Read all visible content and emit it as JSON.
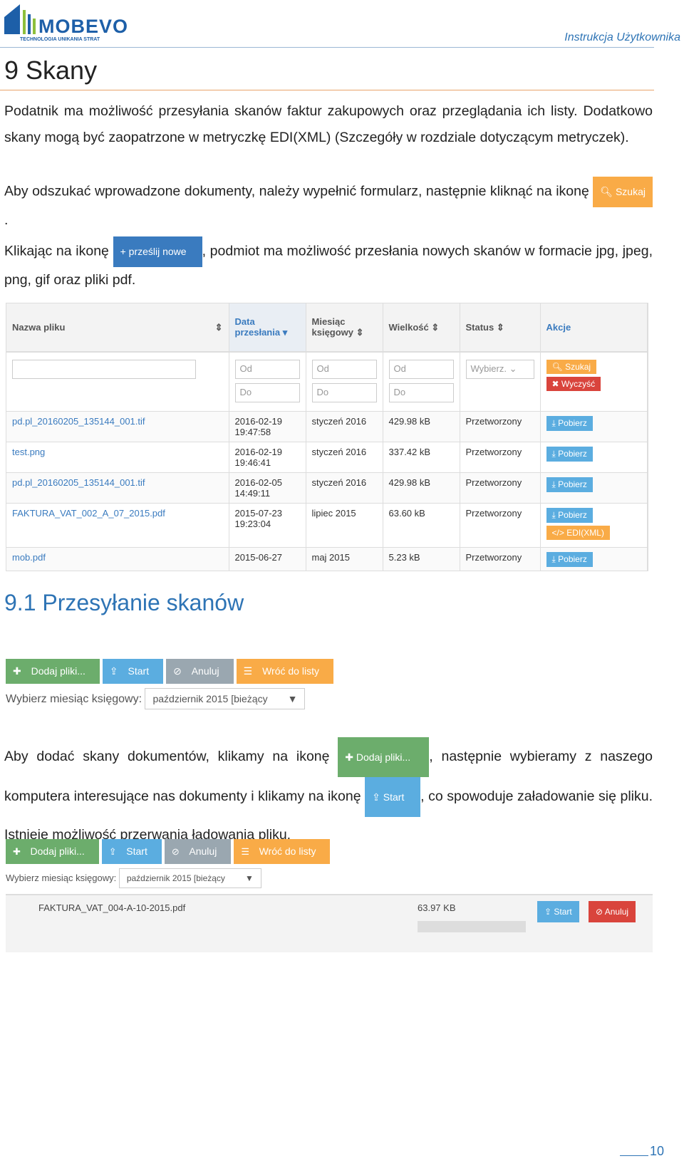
{
  "header": {
    "logo_name": "MOBEVO",
    "logo_tagline": "TECHNOLOGIA UNIKANIA STRAT",
    "right": "Instrukcja Użytkownika"
  },
  "section": {
    "number_title": "9  Skany"
  },
  "para1": "Podatnik ma możliwość przesyłania skanów faktur zakupowych oraz przeglądania ich listy. Dodatkowo skany mogą być zaopatrzone w metryczkę EDI(XML) (Szczegóły w rozdziale dotyczącym metryczek).",
  "para2_pre": "Aby odszukać wprowadzone dokumenty, należy wypełnić formularz, następnie kliknąć na ikonę ",
  "para2_icon": "Szukaj",
  "para2_post": ".",
  "para3_pre": "Klikając na ikonę ",
  "para3_icon": "prześlij nowe",
  "para3_post": ", podmiot ma możliwość przesłania nowych skanów w formacie jpg, jpeg, png, gif oraz pliki pdf.",
  "table": {
    "headers": [
      "Nazwa pliku",
      "Data przesłania",
      "Miesiąc księgowy",
      "Wielkość",
      "Status",
      "Akcje"
    ],
    "filter": {
      "od": "Od",
      "do": "Do",
      "status": "Wybierz.",
      "search": "Szukaj",
      "clear": "Wyczyść"
    },
    "rows": [
      {
        "name": "pd.pl_20160205_135144_001.tif",
        "date": "2016-02-19",
        "time": "19:47:58",
        "month": "styczeń 2016",
        "size": "429.98 kB",
        "status": "Przetworzony",
        "action": "Pobierz"
      },
      {
        "name": "test.png",
        "date": "2016-02-19",
        "time": "19:46:41",
        "month": "styczeń 2016",
        "size": "337.42 kB",
        "status": "Przetworzony",
        "action": "Pobierz"
      },
      {
        "name": "pd.pl_20160205_135144_001.tif",
        "date": "2016-02-05",
        "time": "14:49:11",
        "month": "styczeń 2016",
        "size": "429.98 kB",
        "status": "Przetworzony",
        "action": "Pobierz"
      },
      {
        "name": "FAKTURA_VAT_002_A_07_2015.pdf",
        "date": "2015-07-23",
        "time": "19:23:04",
        "month": "lipiec 2015",
        "size": "63.60 kB",
        "status": "Przetworzony",
        "action": "Pobierz",
        "extra": "EDI(XML)"
      },
      {
        "name": "mob.pdf",
        "date": "2015-06-27",
        "time": "",
        "month": "maj 2015",
        "size": "5.23 kB",
        "status": "Przetworzony",
        "action": "Pobierz"
      }
    ]
  },
  "subsection": {
    "title": "9.1 Przesyłanie skanów"
  },
  "upload": {
    "add": "Dodaj pliki...",
    "start": "Start",
    "cancel": "Anuluj",
    "back": "Wróć do listy",
    "month_label": "Wybierz miesiąc księgowy:",
    "month_value": "październik 2015 [bieżący"
  },
  "para4_pre": "Aby dodać skany dokumentów, klikamy na ikonę ",
  "para4_icon": "Dodaj pliki...",
  "para4_mid": ", następnie wybieramy z naszego komputera interesujące nas dokumenty i klikamy na ikonę ",
  "para4_icon2": "Start",
  "para4_post": ", co spowoduje załadowanie się pliku. Istnieje możliwość przerwania ładowania pliku.",
  "file": {
    "name": "FAKTURA_VAT_004-A-10-2015.pdf",
    "size": "63.97 KB",
    "start": "Start",
    "cancel": "Anuluj",
    "progress": 0
  },
  "footer": {
    "page": "10"
  }
}
